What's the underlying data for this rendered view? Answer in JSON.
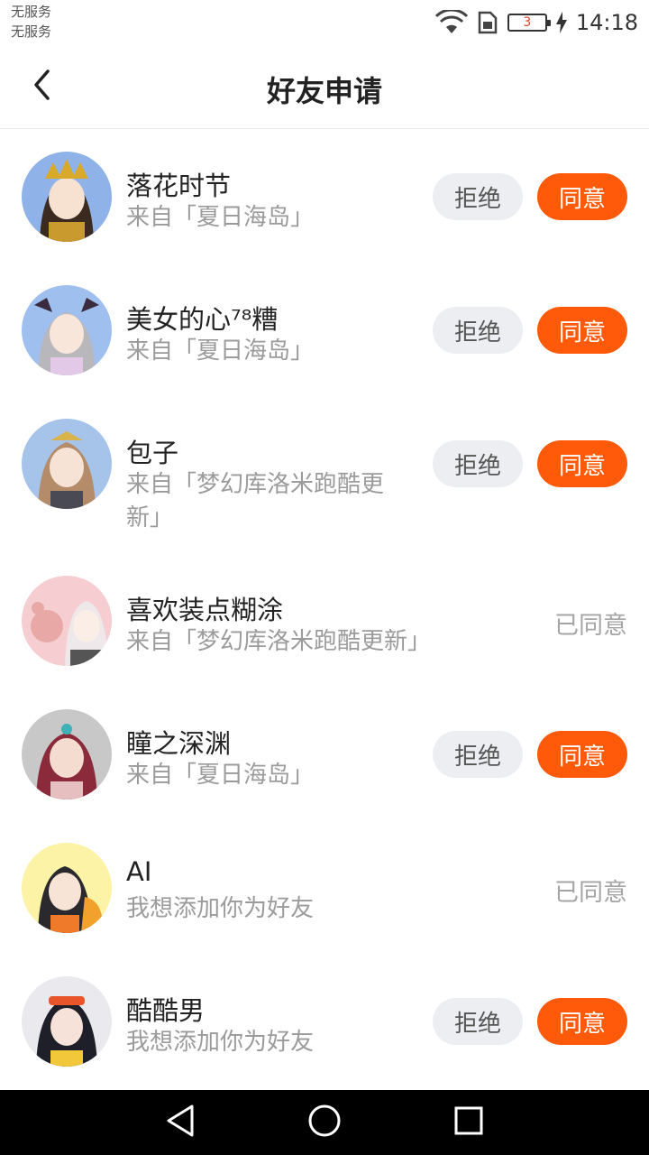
{
  "status_bar": {
    "carrier_line1": "无服务",
    "carrier_line2": "无服务",
    "battery_level": "3",
    "time": "14:18",
    "icons": [
      "wifi-icon",
      "sim-icon",
      "battery-icon",
      "charging-icon"
    ]
  },
  "header": {
    "title": "好友申请",
    "back_icon": "chevron-left-icon"
  },
  "buttons": {
    "reject": "拒绝",
    "accept": "同意"
  },
  "requests": [
    {
      "name": "落花时节",
      "source": "来自「夏日海岛」",
      "status": "pending"
    },
    {
      "name": "美女的心⁷⁸糟",
      "source": "来自「夏日海岛」",
      "status": "pending"
    },
    {
      "name": "包子",
      "source": "来自「梦幻库洛米跑酷更新」",
      "status": "pending"
    },
    {
      "name": "喜欢装点糊涂",
      "source": "来自「梦幻库洛米跑酷更新」",
      "status": "accepted",
      "status_label": "已同意"
    },
    {
      "name": "瞳之深渊",
      "source": "来自「夏日海岛」",
      "status": "pending"
    },
    {
      "name": "AI",
      "source": "我想添加你为好友",
      "status": "accepted",
      "status_label": "已同意"
    },
    {
      "name": "酷酷男",
      "source": "我想添加你为好友",
      "status": "pending"
    }
  ],
  "colors": {
    "accent": "#ff5a0a",
    "reject_bg": "#eceef2",
    "muted_text": "#9b9b9b"
  },
  "navbar": {
    "icons": [
      "back-triangle-icon",
      "home-circle-icon",
      "recents-square-icon"
    ]
  }
}
